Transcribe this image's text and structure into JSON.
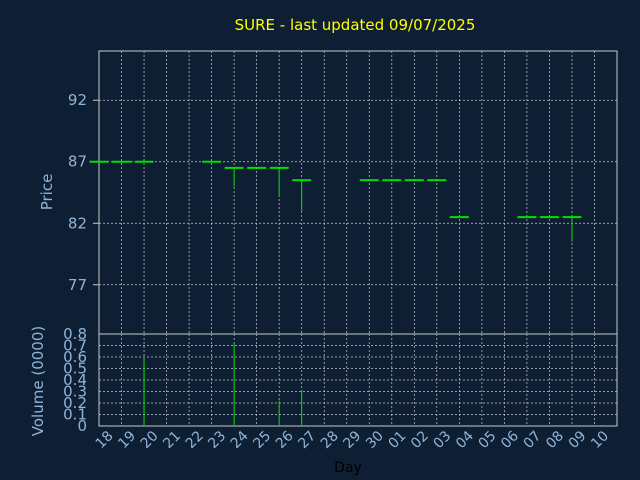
{
  "title": "SURE - last updated 09/07/2025",
  "colors": {
    "background": "#0f1f33",
    "grid": "#c8c8c8",
    "title": "#ffff00",
    "axis_text": "#8fb4d8",
    "bars": "#00e000"
  },
  "chart_data": [
    {
      "type": "ohlc",
      "ylabel": "Price",
      "ylim": [
        73,
        96
      ],
      "yticks": [
        77,
        82,
        87,
        92
      ],
      "grid": true,
      "categories": [
        "18",
        "19",
        "20",
        "21",
        "22",
        "23",
        "24",
        "25",
        "26",
        "27",
        "28",
        "29",
        "30",
        "01",
        "02",
        "03",
        "04",
        "05",
        "06",
        "07",
        "08",
        "09",
        "10"
      ],
      "bars": [
        {
          "x": "18",
          "open": 87.0,
          "high": 87.0,
          "low": 87.0,
          "close": 87.0
        },
        {
          "x": "19",
          "open": 87.0,
          "high": 87.0,
          "low": 87.0,
          "close": 87.0
        },
        {
          "x": "20",
          "open": 87.0,
          "high": 87.2,
          "low": 87.0,
          "close": 87.0
        },
        {
          "x": "23",
          "open": 87.0,
          "high": 87.0,
          "low": 87.0,
          "close": 87.0
        },
        {
          "x": "24",
          "open": 86.5,
          "high": 86.5,
          "low": 85.0,
          "close": 86.5
        },
        {
          "x": "25",
          "open": 86.5,
          "high": 86.5,
          "low": 86.5,
          "close": 86.5
        },
        {
          "x": "26",
          "open": 86.5,
          "high": 86.5,
          "low": 84.2,
          "close": 86.5
        },
        {
          "x": "27",
          "open": 85.5,
          "high": 85.5,
          "low": 83.0,
          "close": 85.5
        },
        {
          "x": "30",
          "open": 85.5,
          "high": 85.5,
          "low": 85.5,
          "close": 85.5
        },
        {
          "x": "01",
          "open": 85.5,
          "high": 85.5,
          "low": 85.5,
          "close": 85.5
        },
        {
          "x": "02",
          "open": 85.5,
          "high": 85.5,
          "low": 85.5,
          "close": 85.5
        },
        {
          "x": "03",
          "open": 85.5,
          "high": 85.5,
          "low": 85.5,
          "close": 85.5
        },
        {
          "x": "04",
          "open": 82.5,
          "high": 82.5,
          "low": 82.5,
          "close": 82.5
        },
        {
          "x": "07",
          "open": 82.5,
          "high": 82.5,
          "low": 82.5,
          "close": 82.5
        },
        {
          "x": "08",
          "open": 82.5,
          "high": 82.5,
          "low": 82.5,
          "close": 82.5
        },
        {
          "x": "09",
          "open": 82.5,
          "high": 82.5,
          "low": 80.5,
          "close": 82.5
        }
      ]
    },
    {
      "type": "bar",
      "ylabel": "Volume (0000)",
      "xlabel": "Day",
      "ylim": [
        0,
        0.8
      ],
      "yticks": [
        "0",
        "0.1",
        "0.2",
        "0.3",
        "0.4",
        "0.5",
        "0.6",
        "0.7",
        "0.8"
      ],
      "grid": true,
      "categories": [
        "18",
        "19",
        "20",
        "21",
        "22",
        "23",
        "24",
        "25",
        "26",
        "27",
        "28",
        "29",
        "30",
        "01",
        "02",
        "03",
        "04",
        "05",
        "06",
        "07",
        "08",
        "09",
        "10"
      ],
      "values": [
        0,
        0,
        0.58,
        0,
        0,
        0,
        0.72,
        0,
        0.22,
        0.31,
        0,
        0,
        0,
        0,
        0,
        0,
        0,
        0,
        0,
        0,
        0,
        0,
        0
      ]
    }
  ]
}
